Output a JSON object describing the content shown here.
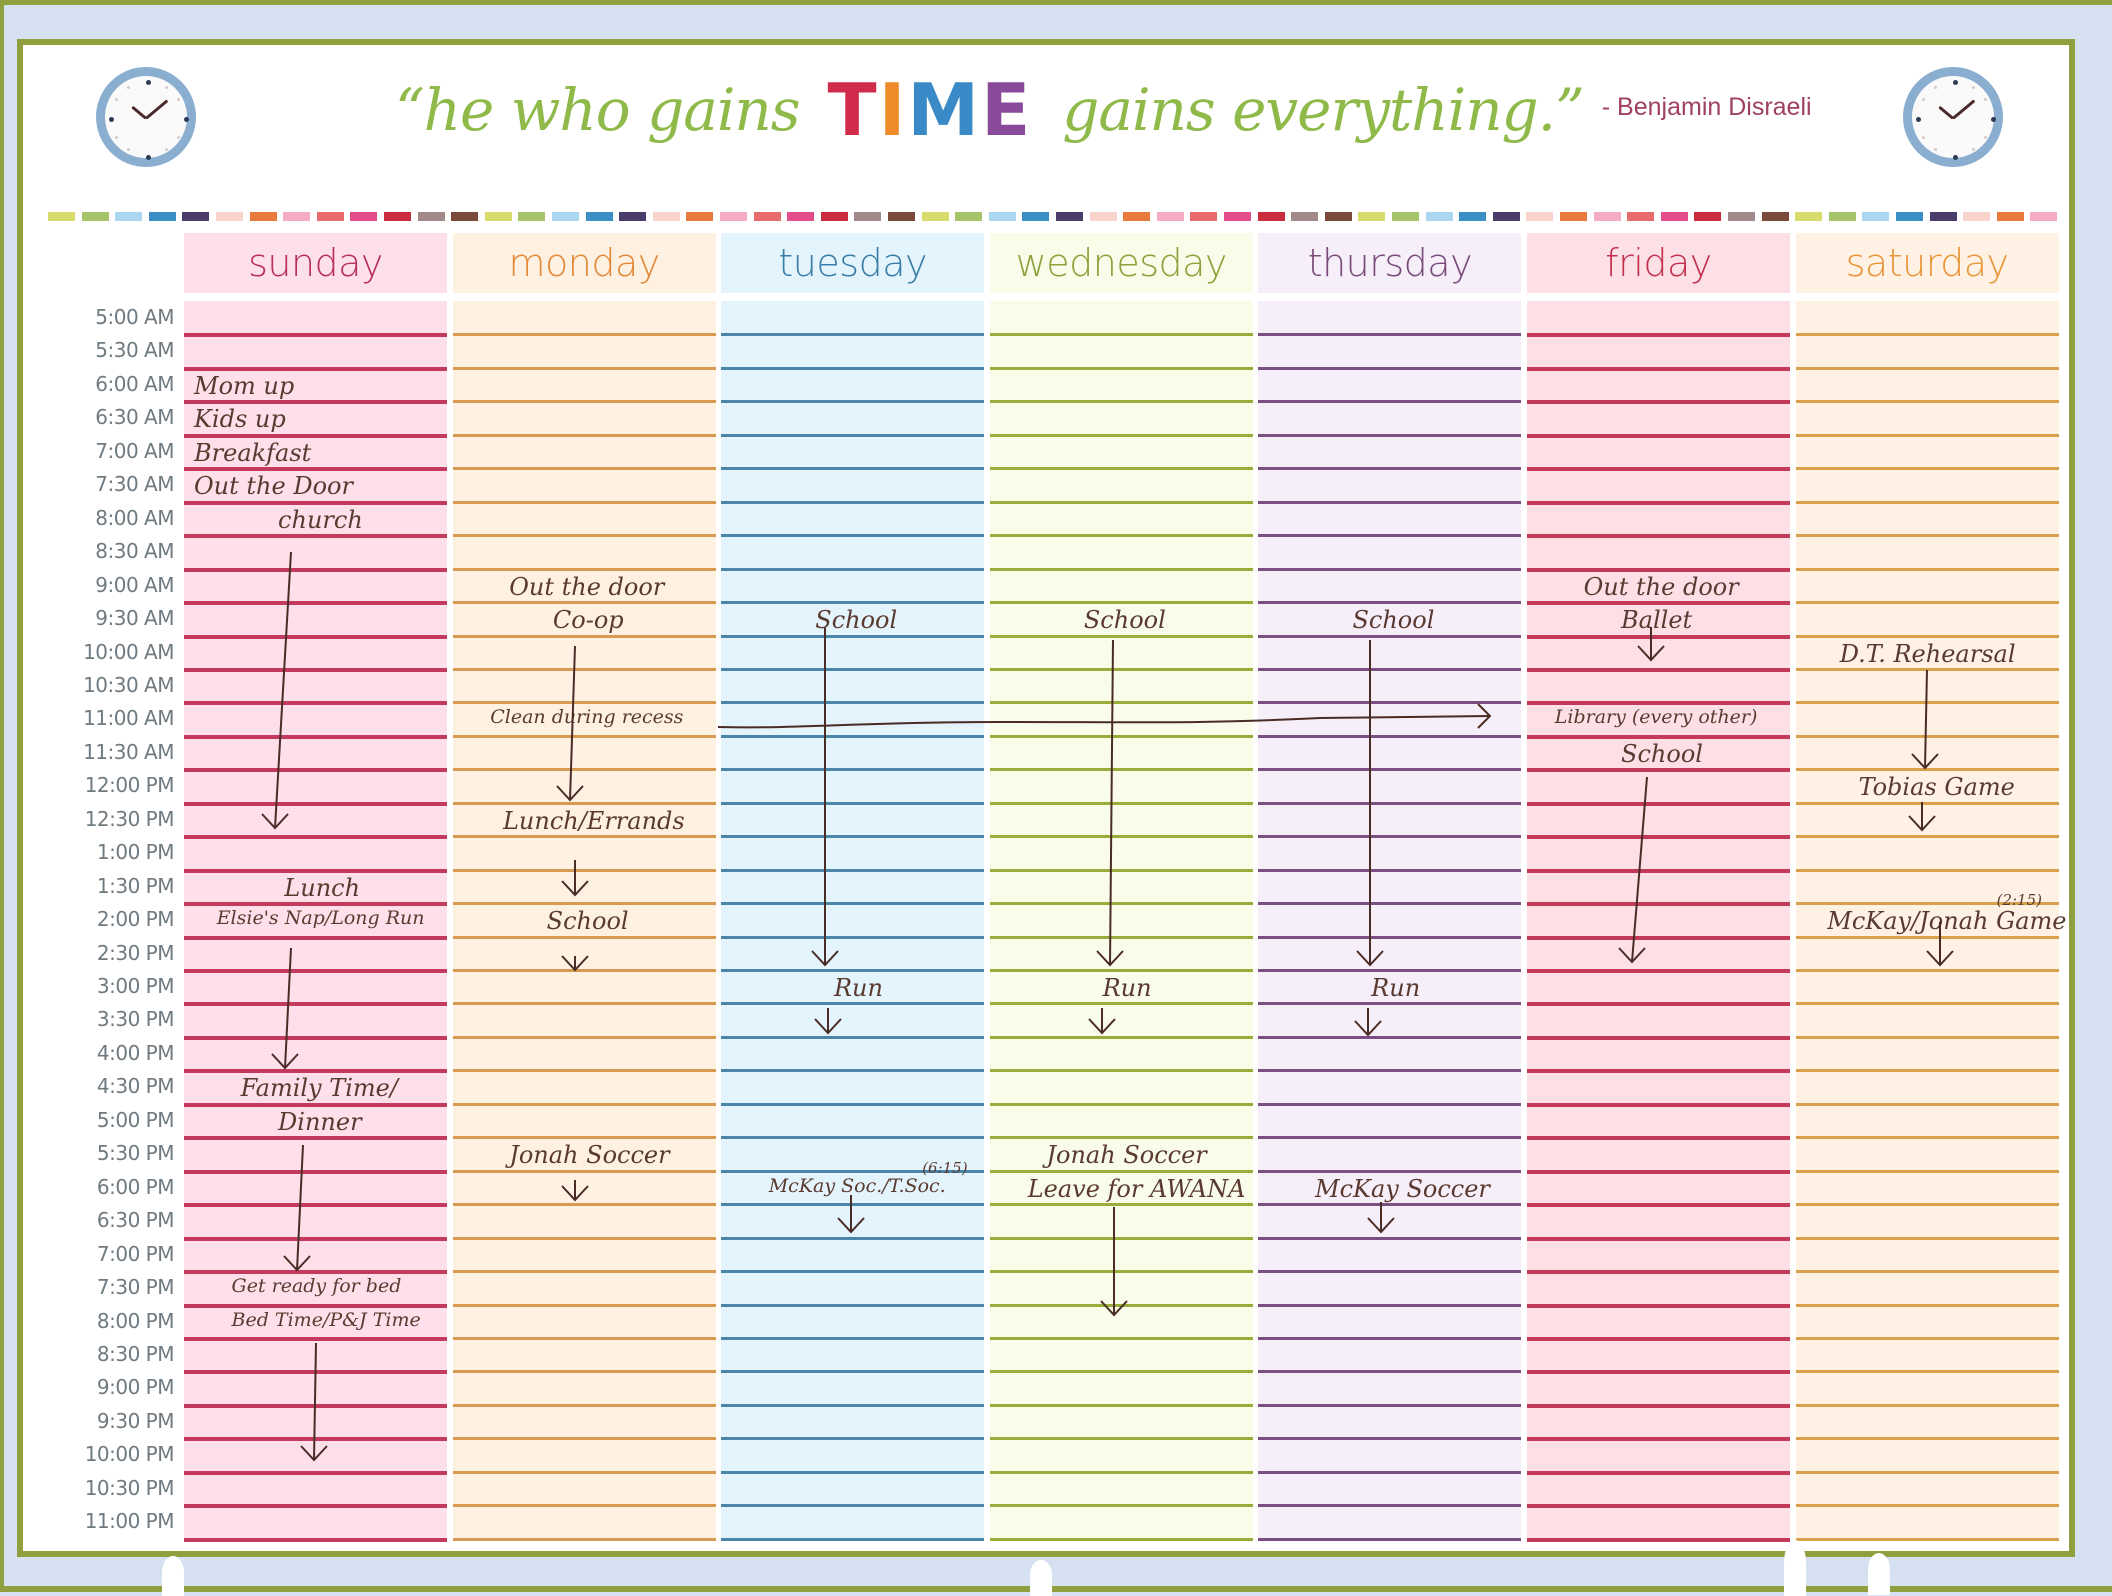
{
  "header": {
    "quote_part1": "“he who gains",
    "quote_highlight_letters": [
      {
        "char": "T",
        "color": "#d02a4c"
      },
      {
        "char": "I",
        "color": "#ee8a2a"
      },
      {
        "char": "M",
        "color": "#3a8ac8"
      },
      {
        "char": "E",
        "color": "#8a4a9a"
      }
    ],
    "quote_part2": "gains everything.”",
    "author": "- Benjamin Disraeli",
    "left_icon": "clock-icon",
    "right_icon": "clock-icon"
  },
  "colors": {
    "frame_green": "#8f9f3e",
    "frame_blue": "#d5e1f1",
    "script_green": "#8fba4a",
    "author_color": "#a04060",
    "ink": "#5a3a30",
    "dash_palette": [
      "#d8dc6a",
      "#a6c46a",
      "#aad6ef",
      "#3b8fc7",
      "#4b3d6b",
      "#f7d3cc",
      "#e9793c",
      "#f5acc2",
      "#e86c6e",
      "#e24c8a",
      "#c92c3c",
      "#a38a8a",
      "#7a4a3a"
    ]
  },
  "days": [
    {
      "name": "sunday",
      "text_color": "#b8305a",
      "bg": "#fde0ea",
      "line": "#c23a5e"
    },
    {
      "name": "monday",
      "text_color": "#e28a3a",
      "bg": "#fff1e2",
      "line": "#d89a52"
    },
    {
      "name": "tuesday",
      "text_color": "#3a7ea8",
      "bg": "#e4f4fc",
      "line": "#4a86aa"
    },
    {
      "name": "wednesday",
      "text_color": "#8ca23a",
      "bg": "#f8fce8",
      "line": "#9cac3a"
    },
    {
      "name": "thursday",
      "text_color": "#7a4a7a",
      "bg": "#f6effa",
      "line": "#7a5082"
    },
    {
      "name": "friday",
      "text_color": "#c2304e",
      "bg": "#fde0e6",
      "line": "#c23a5a"
    },
    {
      "name": "saturday",
      "text_color": "#e8963a",
      "bg": "#fff1e4",
      "line": "#d8a04a"
    }
  ],
  "time_slots": [
    "5:00 AM",
    "5:30 AM",
    "6:00 AM",
    "6:30 AM",
    "7:00 AM",
    "7:30 AM",
    "8:00 AM",
    "8:30 AM",
    "9:00 AM",
    "9:30 AM",
    "10:00 AM",
    "10:30 AM",
    "11:00 AM",
    "11:30 AM",
    "12:00 PM",
    "12:30 PM",
    "1:00 PM",
    "1:30 PM",
    "2:00 PM",
    "2:30 PM",
    "3:00 PM",
    "3:30 PM",
    "4:00 PM",
    "4:30 PM",
    "5:00 PM",
    "5:30 PM",
    "6:00 PM",
    "6:30 PM",
    "7:00 PM",
    "7:30 PM",
    "8:00 PM",
    "8:30 PM",
    "9:00 PM",
    "9:30 PM",
    "10:00 PM",
    "10:30 PM",
    "11:00 PM"
  ],
  "entries": {
    "sunday": [
      {
        "slot": "6:00 AM",
        "text": "Mom up"
      },
      {
        "slot": "6:30 AM",
        "text": "Kids up"
      },
      {
        "slot": "7:00 AM",
        "text": "Breakfast"
      },
      {
        "slot": "7:30 AM",
        "text": "Out the Door"
      },
      {
        "slot": "8:00 AM",
        "text": "church"
      },
      {
        "slot": "1:30 PM",
        "text": "Lunch"
      },
      {
        "slot": "2:00 PM",
        "text": "Elsie's Nap/Long Run"
      },
      {
        "slot": "4:30 PM",
        "text": "Family Time/"
      },
      {
        "slot": "5:00 PM",
        "text": "Dinner"
      },
      {
        "slot": "7:30 PM",
        "text": "Get ready for bed"
      },
      {
        "slot": "8:00 PM",
        "text": "Bed Time/P&J Time"
      }
    ],
    "monday": [
      {
        "slot": "9:00 AM",
        "text": "Out the door"
      },
      {
        "slot": "9:30 AM",
        "text": "Co-op"
      },
      {
        "slot": "11:00 AM",
        "text": "Clean during recess"
      },
      {
        "slot": "12:30 PM",
        "text": "Lunch/Errands"
      },
      {
        "slot": "2:00 PM",
        "text": "School"
      },
      {
        "slot": "5:30 PM",
        "text": "Jonah Soccer"
      }
    ],
    "tuesday": [
      {
        "slot": "9:30 AM",
        "text": "School"
      },
      {
        "slot": "3:00 PM",
        "text": "Run"
      },
      {
        "slot": "6:00 PM",
        "text": "McKay Soc./T.Soc.",
        "note": "(6:15)"
      }
    ],
    "wednesday": [
      {
        "slot": "9:30 AM",
        "text": "School"
      },
      {
        "slot": "3:00 PM",
        "text": "Run"
      },
      {
        "slot": "5:30 PM",
        "text": "Jonah Soccer"
      },
      {
        "slot": "6:00 PM",
        "text": "Leave for AWANA"
      }
    ],
    "thursday": [
      {
        "slot": "9:30 AM",
        "text": "School"
      },
      {
        "slot": "3:00 PM",
        "text": "Run"
      },
      {
        "slot": "6:00 PM",
        "text": "McKay Soccer"
      }
    ],
    "friday": [
      {
        "slot": "9:00 AM",
        "text": "Out the door"
      },
      {
        "slot": "9:30 AM",
        "text": "Ballet"
      },
      {
        "slot": "11:00 AM",
        "text": "Library (every other)"
      },
      {
        "slot": "11:30 AM",
        "text": "School"
      }
    ],
    "saturday": [
      {
        "slot": "10:00 AM",
        "text": "D.T. Rehearsal"
      },
      {
        "slot": "12:00 PM",
        "text": "Tobias Game"
      },
      {
        "slot": "2:00 PM",
        "text": "McKay/Jonah Game",
        "note": "(2:15)"
      }
    ]
  }
}
